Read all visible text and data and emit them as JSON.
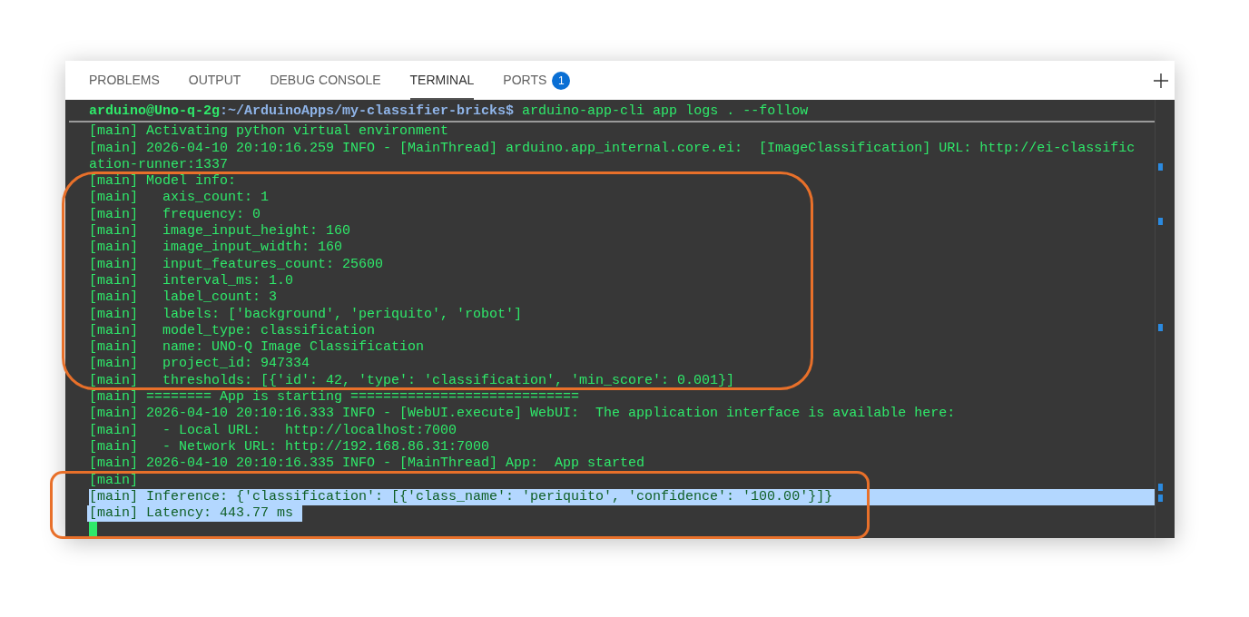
{
  "tabs": [
    {
      "label": "PROBLEMS",
      "selected": false
    },
    {
      "label": "OUTPUT",
      "selected": false
    },
    {
      "label": "DEBUG CONSOLE",
      "selected": false
    },
    {
      "label": "TERMINAL",
      "selected": true
    },
    {
      "label": "PORTS",
      "selected": false,
      "badge": "1"
    }
  ],
  "prompt": {
    "user_host": "arduino@Uno-q-2g",
    "path": ":~/ArduinoApps/my-classifier-bricks$",
    "command": " arduino-app-cli app logs . --follow"
  },
  "lines": [
    {
      "text": "[main] Activating python virtual environment",
      "selected": false
    },
    {
      "text": "[main] 2026-04-10 20:10:16.259 INFO - [MainThread] arduino.app_internal.core.ei:  [ImageClassification] URL: http://ei-classific",
      "selected": false
    },
    {
      "text": "ation-runner:1337",
      "selected": false
    },
    {
      "text": "[main] Model info:",
      "selected": false
    },
    {
      "text": "[main]   axis_count: 1",
      "selected": false
    },
    {
      "text": "[main]   frequency: 0",
      "selected": false
    },
    {
      "text": "[main]   image_input_height: 160",
      "selected": false
    },
    {
      "text": "[main]   image_input_width: 160",
      "selected": false
    },
    {
      "text": "[main]   input_features_count: 25600",
      "selected": false
    },
    {
      "text": "[main]   interval_ms: 1.0",
      "selected": false
    },
    {
      "text": "[main]   label_count: 3",
      "selected": false
    },
    {
      "text": "[main]   labels: ['background', 'periquito', 'robot']",
      "selected": false
    },
    {
      "text": "[main]   model_type: classification",
      "selected": false
    },
    {
      "text": "[main]   name: UNO-Q Image Classification",
      "selected": false
    },
    {
      "text": "[main]   project_id: 947334",
      "selected": false
    },
    {
      "text": "[main]   thresholds: [{'id': 42, 'type': 'classification', 'min_score': 0.001}]",
      "selected": false
    },
    {
      "text": "[main] ======== App is starting ============================",
      "selected": false
    },
    {
      "text": "[main] 2026-04-10 20:10:16.333 INFO - [WebUI.execute] WebUI:  The application interface is available here:",
      "selected": false
    },
    {
      "text": "[main]   - Local URL:   http://localhost:7000",
      "selected": false
    },
    {
      "text": "[main]   - Network URL: http://192.168.86.31:7000",
      "selected": false
    },
    {
      "text": "[main] 2026-04-10 20:10:16.335 INFO - [MainThread] App:  App started",
      "selected": false
    },
    {
      "text": "[main]",
      "selected": false
    },
    {
      "text": "[main] Inference: {'classification': [{'class_name': 'periquito', 'confidence': '100.00'}]}",
      "selected": true,
      "highlight_to_edge": true
    },
    {
      "text": "[main] Latency: 443.77 ms",
      "selected": true,
      "highlight_to_edge": false
    }
  ]
}
